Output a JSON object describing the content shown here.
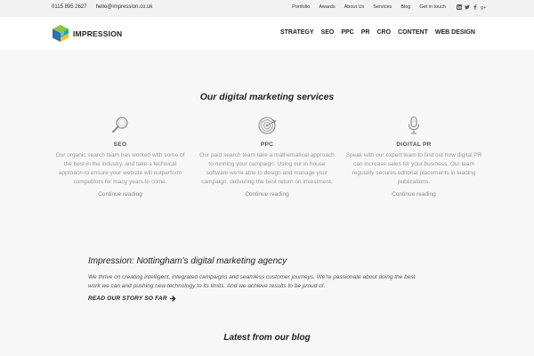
{
  "topbar": {
    "phone": "0115 895 2627",
    "email": "hello@impression.co.uk",
    "links": [
      "Portfolio",
      "Awards",
      "About Us",
      "Services",
      "Blog",
      "Get in touch"
    ],
    "social_icons": [
      "linkedin-icon",
      "twitter-icon",
      "facebook-icon",
      "google-plus-icon"
    ]
  },
  "header": {
    "logo_text": "IMPRESSION",
    "nav": [
      "STRATEGY",
      "SEO",
      "PPC",
      "PR",
      "CRO",
      "CONTENT",
      "WEB DESIGN"
    ]
  },
  "services": {
    "title": "Our digital marketing services",
    "items": [
      {
        "icon": "magnifier-icon",
        "title": "SEO",
        "desc": "Our organic search team has worked with some of the best in the industry, and take a technical approach to ensure your website will outperform competitors for many years to come.",
        "more": "Continue reading"
      },
      {
        "icon": "target-icon",
        "title": "PPC",
        "desc": "Our paid search team take a mathematical approach to running your campaign. Using our in house software we're able to design and manage your campaign, delivering the best return on investment.",
        "more": "Continue reading"
      },
      {
        "icon": "microphone-icon",
        "title": "DIGITAL PR",
        "desc": "Speak with our expert team to find out how digital PR can increase sales for your business. Our team regularly secures editorial placements in leading publications.",
        "more": "Continue reading"
      }
    ]
  },
  "agency": {
    "title": "Impression: Nottingham's digital marketing agency",
    "text": "We thrive on creating intelligent, integrated campaigns and seamless customer journeys. We're passionate about doing the best work we can and pushing new technology to its limits. And we achieve results to be proud of.",
    "cta": "READ OUR STORY SO FAR"
  },
  "blog": {
    "title": "Latest from our blog"
  },
  "colors": {
    "logo_blue": "#2b6fb6",
    "logo_green": "#8cc63f",
    "logo_yellow": "#f5c518",
    "logo_teal": "#1aa5b8"
  }
}
